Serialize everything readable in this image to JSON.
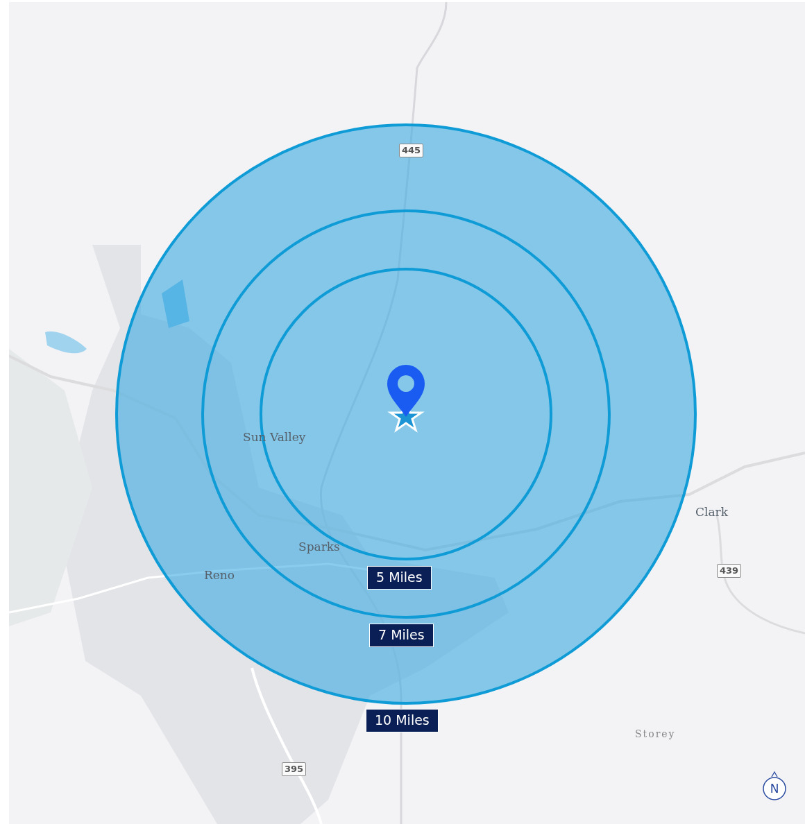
{
  "map": {
    "places": [
      {
        "name": "Sun Valley"
      },
      {
        "name": "Sparks"
      },
      {
        "name": "Reno"
      },
      {
        "name": "Clark"
      },
      {
        "name": "Storey"
      }
    ],
    "highway_shields": [
      {
        "number": "445"
      },
      {
        "number": "439"
      },
      {
        "number": "395"
      }
    ],
    "radius_rings": [
      {
        "label": "5 Miles"
      },
      {
        "label": "7 Miles"
      },
      {
        "label": "10 Miles"
      }
    ],
    "compass": {
      "label": "N"
    }
  }
}
